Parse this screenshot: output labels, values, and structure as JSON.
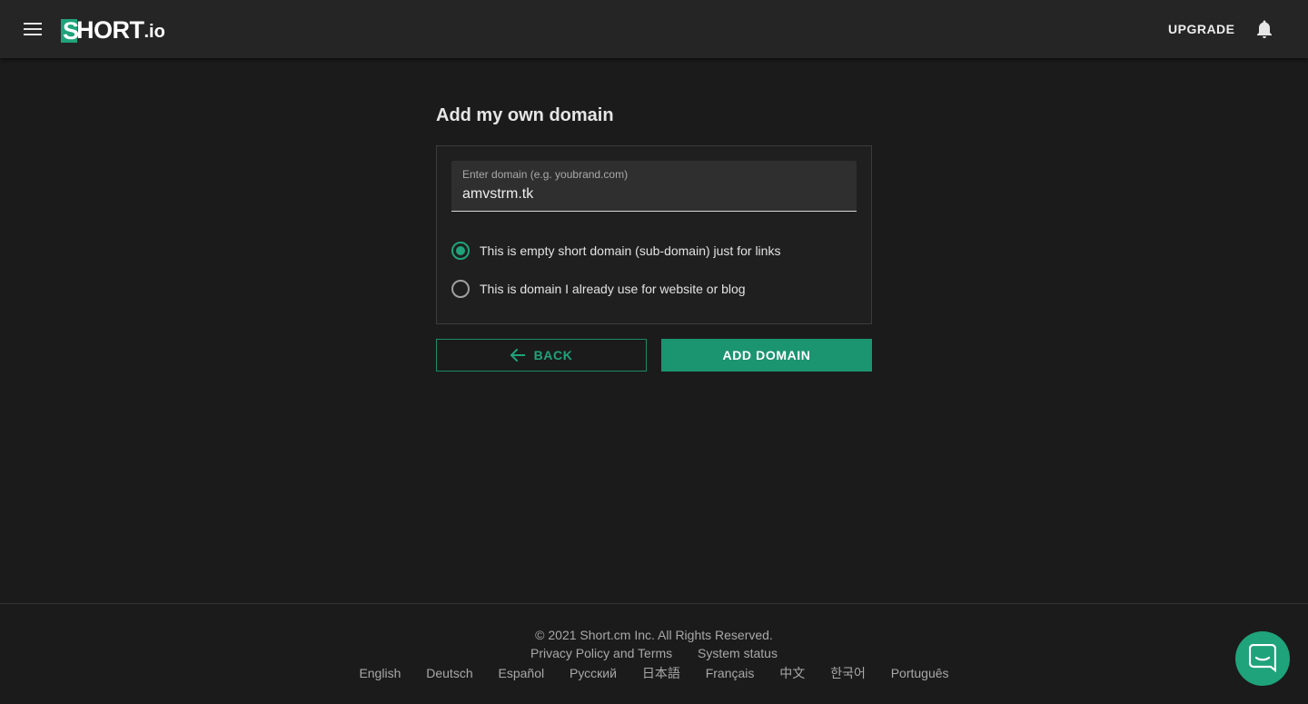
{
  "header": {
    "logo": {
      "s": "S",
      "text": "HORT",
      "tld": ".io"
    },
    "upgrade_label": "UPGRADE",
    "menu_icon": "hamburger-menu-icon",
    "bell_icon": "bell-icon"
  },
  "main": {
    "title": "Add my own domain",
    "domain_field": {
      "label": "Enter domain (e.g. youbrand.com)",
      "value": "amvstrm.tk"
    },
    "options": [
      {
        "label": "This is empty short domain (sub-domain) just for links",
        "checked": true
      },
      {
        "label": "This is domain I already use for website or blog",
        "checked": false
      }
    ],
    "back_label": "BACK",
    "add_label": "ADD DOMAIN"
  },
  "footer": {
    "copyright": "© 2021  Short.cm Inc. All Rights Reserved.",
    "links": [
      "Privacy Policy and Terms",
      "System status"
    ],
    "languages": [
      "English",
      "Deutsch",
      "Español",
      "Русский",
      "日本語",
      "Français",
      "中文",
      "한국어",
      "Português"
    ]
  },
  "colors": {
    "accent": "#1fa37a",
    "background": "#1b1b1b",
    "header": "#252525"
  }
}
